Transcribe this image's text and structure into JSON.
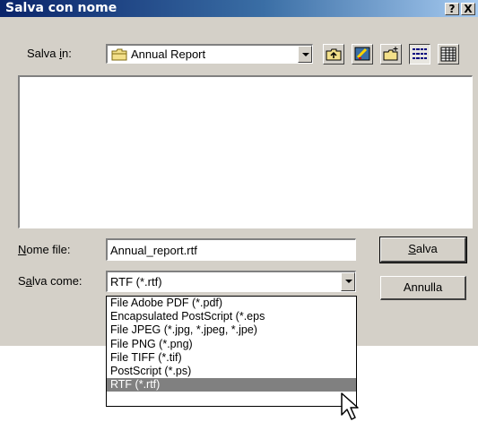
{
  "window": {
    "title": "Salva con nome",
    "help_label": "?",
    "close_label": "X"
  },
  "toolbar": {
    "save_in_label_pre": "Salva ",
    "save_in_label_u": "i",
    "save_in_label_post": "n:",
    "location": "Annual Report",
    "buttons": [
      "up-one-level-icon",
      "desktop-icon",
      "new-folder-icon",
      "list-view-icon",
      "details-view-icon"
    ]
  },
  "form": {
    "filename_label_u": "N",
    "filename_label_post": "ome file:",
    "filename_value": "Annual_report.rtf",
    "savetype_label_pre": "S",
    "savetype_label_u": "a",
    "savetype_label_post": "lva come:",
    "savetype_value": "RTF (*.rtf)"
  },
  "buttons": {
    "save_u": "S",
    "save_post": "alva",
    "cancel": "Annulla"
  },
  "dropdown": {
    "options": [
      "File Adobe PDF  (*.pdf)",
      "Encapsulated PostScript (*.eps",
      "File JPEG (*.jpg, *.jpeg, *.jpe)",
      "File PNG (*.png)",
      "File TIFF (*.tif)",
      "PostScript (*.ps)",
      "RTF (*.rtf)"
    ],
    "selected_index": 6
  },
  "colors": {
    "face": "#d4d0c8",
    "title_start": "#0a246a",
    "highlight": "#808080"
  }
}
